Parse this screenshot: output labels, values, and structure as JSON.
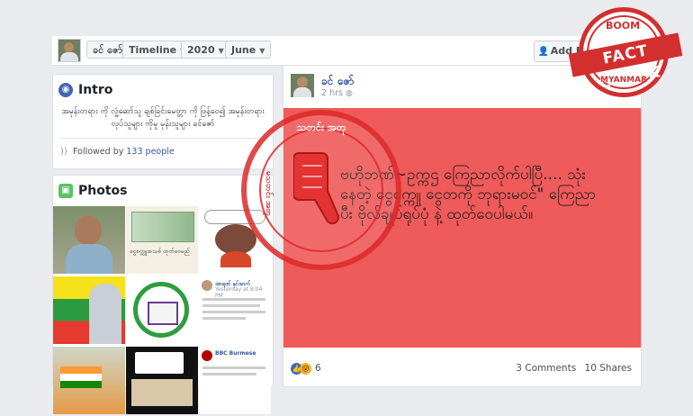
{
  "topbar": {
    "name": "ခင် ဇော်",
    "timeline_label": "Timeline",
    "year_label": "2020",
    "month_label": "June",
    "add_friend_label": "Add Friend"
  },
  "intro": {
    "heading": "Intro",
    "bio": "အမုန်းတရား ကို လှုံ့ဆော်သူ ချစ်ခြင်းမေတ္တာ ကို ဖြန့်ဝေ၍ အမုန်းတရား လုပ်သူများ ကိုမူ မုန်းသူများ ခင်ဇော်",
    "followed_prefix": "Followed by",
    "followed_count": "133 people"
  },
  "photos": {
    "heading": "Photos",
    "cap2": "ငွေစက္ကူအသစ် ထုတ်ဝေမည်",
    "ph6_title": "အာရုဏ် နှင်းဆက်",
    "ph6_time": "Yesterday at 8:04 PM",
    "ph9_title": "BBC Burmese"
  },
  "post": {
    "author": "ခင် ဇော်",
    "time": "2 hrs",
    "text": "ဗဟိုဘဏ်~ဥက္ကဌ ကြေညာလိုက်ပါပြီ.... သုံးနေတဲ့ ငွေစက္ကူ ငွေတကို ဘုရားမဝင်\" ကြေညာပီး ဗိုလ်ချုပ်ရုပ်ပုံ နဲ့ ထုတ်ဝေပါမယ်။",
    "reaction_count": "6",
    "comments": "3 Comments",
    "shares": "10 Shares"
  },
  "stamp": {
    "top_text": "သတင်း အတု",
    "side_text": "မသတင်း အတု"
  },
  "badge": {
    "boom": "BOOM",
    "fact_check": "FACT CHECK",
    "region": "MYANMAR"
  },
  "colors": {
    "post_background": "#ef5a5a",
    "stamp_red": "#dc2828",
    "facebook_blue": "#4267b2"
  }
}
